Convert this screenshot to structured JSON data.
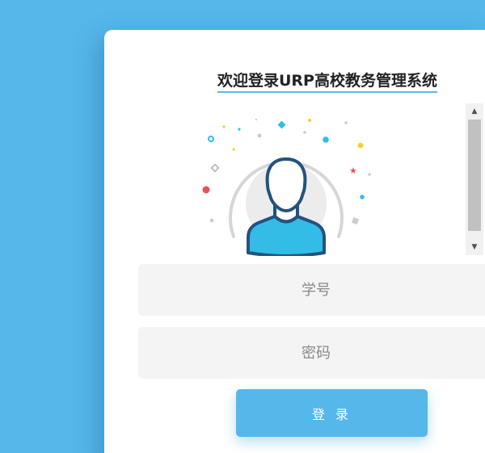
{
  "page": {
    "title": "欢迎登录URP高校教务管理系统"
  },
  "colors": {
    "background": "#56b7ea",
    "accent": "#56b7ea",
    "card": "#ffffff",
    "avatar_body": "#33bde6",
    "avatar_outline": "#24527f"
  },
  "illustration": {
    "icon": "user-avatar-icon"
  },
  "form": {
    "username_placeholder": "学号",
    "password_placeholder": "密码",
    "login_label": "登 录"
  }
}
